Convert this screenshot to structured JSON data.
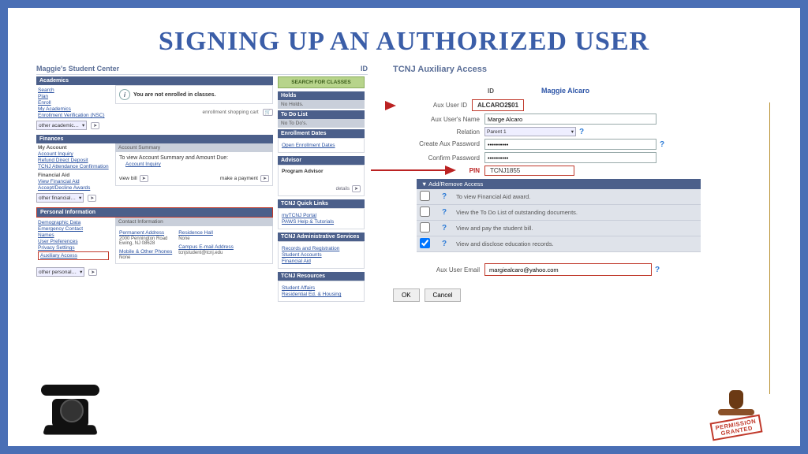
{
  "title": "SIGNING UP AN AUTHORIZED USER",
  "student_center": {
    "heading": "Maggie's Student Center",
    "id_label": "ID",
    "academics": {
      "bar": "Academics",
      "links": [
        "Search",
        "Plan",
        "Enroll",
        "My Academics",
        "Enrollment Verification (NSC)"
      ],
      "not_enrolled": "You are not enrolled in classes.",
      "shopping_cart": "enrollment shopping cart",
      "dropdown": "other academic…"
    },
    "finances": {
      "bar": "Finances",
      "my_account": "My Account",
      "acct_links": [
        "Account Inquiry",
        "Refund Direct Deposit",
        "TCNJ Attendance Confirmation"
      ],
      "fin_aid": "Financial Aid",
      "fin_links": [
        "View Financial Aid",
        "Accept/Decline Awards"
      ],
      "summary_hdr": "Account Summary",
      "summary_txt": "To view Account Summary and Amount Due:",
      "summary_link": "Account Inquiry",
      "view_bill": "view bill",
      "make_payment": "make a payment",
      "dropdown": "other financial…"
    },
    "personal": {
      "bar": "Personal Information",
      "links": [
        "Demographic Data",
        "Emergency Contact",
        "Names",
        "User Preferences",
        "Privacy Settings",
        "Auxiliary Access"
      ],
      "contact_hdr": "Contact Information",
      "perm_addr_lbl": "Permanent Address",
      "perm_addr_val": "2000 Pennington Road\nEwing, NJ 08628",
      "res_hall_lbl": "Residence Hall",
      "none": "None",
      "phones_lbl": "Mobile & Other Phones",
      "campus_email_lbl": "Campus E-mail Address",
      "campus_email_val": "tcnjstudent@tcnj.edu",
      "dropdown": "other personal…"
    },
    "right": {
      "search_btn": "SEARCH FOR CLASSES",
      "holds_bar": "Holds",
      "holds_txt": "No Holds.",
      "todo_bar": "To Do List",
      "todo_txt": "No To Do's.",
      "enroll_bar": "Enrollment Dates",
      "enroll_link": "Open Enrollment Dates",
      "advisor_bar": "Advisor",
      "advisor_txt": "Program Advisor",
      "details": "details",
      "ql_bar": "TCNJ Quick Links",
      "ql_links": [
        "myTCNJ Portal",
        "PAWS Help & Tutorials"
      ],
      "admin_bar": "TCNJ Administrative Services",
      "admin_links": [
        "Records and Registration",
        "Student Accounts",
        "Financial Aid"
      ],
      "res_bar": "TCNJ Resources",
      "res_links": [
        "Student Affairs",
        "Residential Ed. & Housing"
      ]
    }
  },
  "aux": {
    "heading": "TCNJ Auxiliary Access",
    "id_header": "ID",
    "name_display": "Maggie Alcaro",
    "labels": {
      "aux_id": "Aux User ID",
      "aux_name": "Aux User's Name",
      "relation": "Relation",
      "create_pw": "Create Aux Password",
      "confirm_pw": "Confirm Password",
      "pin": "PIN",
      "email": "Aux User Email"
    },
    "values": {
      "aux_id": "ALCARO2$01",
      "aux_name": "Marge Alcaro",
      "relation": "Parent 1",
      "pin": "TCNJ1855",
      "email": "margiealcaro@yahoo.com"
    },
    "perm_header": "Add/Remove Access",
    "perms": [
      {
        "checked": false,
        "text": "To view Financial Aid award."
      },
      {
        "checked": false,
        "text": "View the To Do List of outstanding documents."
      },
      {
        "checked": false,
        "text": "View  and pay the student bill."
      },
      {
        "checked": true,
        "text": "View and disclose education records."
      }
    ],
    "buttons": {
      "ok": "OK",
      "cancel": "Cancel"
    }
  },
  "stamp_text": "PERMISSION\nGRANTED"
}
